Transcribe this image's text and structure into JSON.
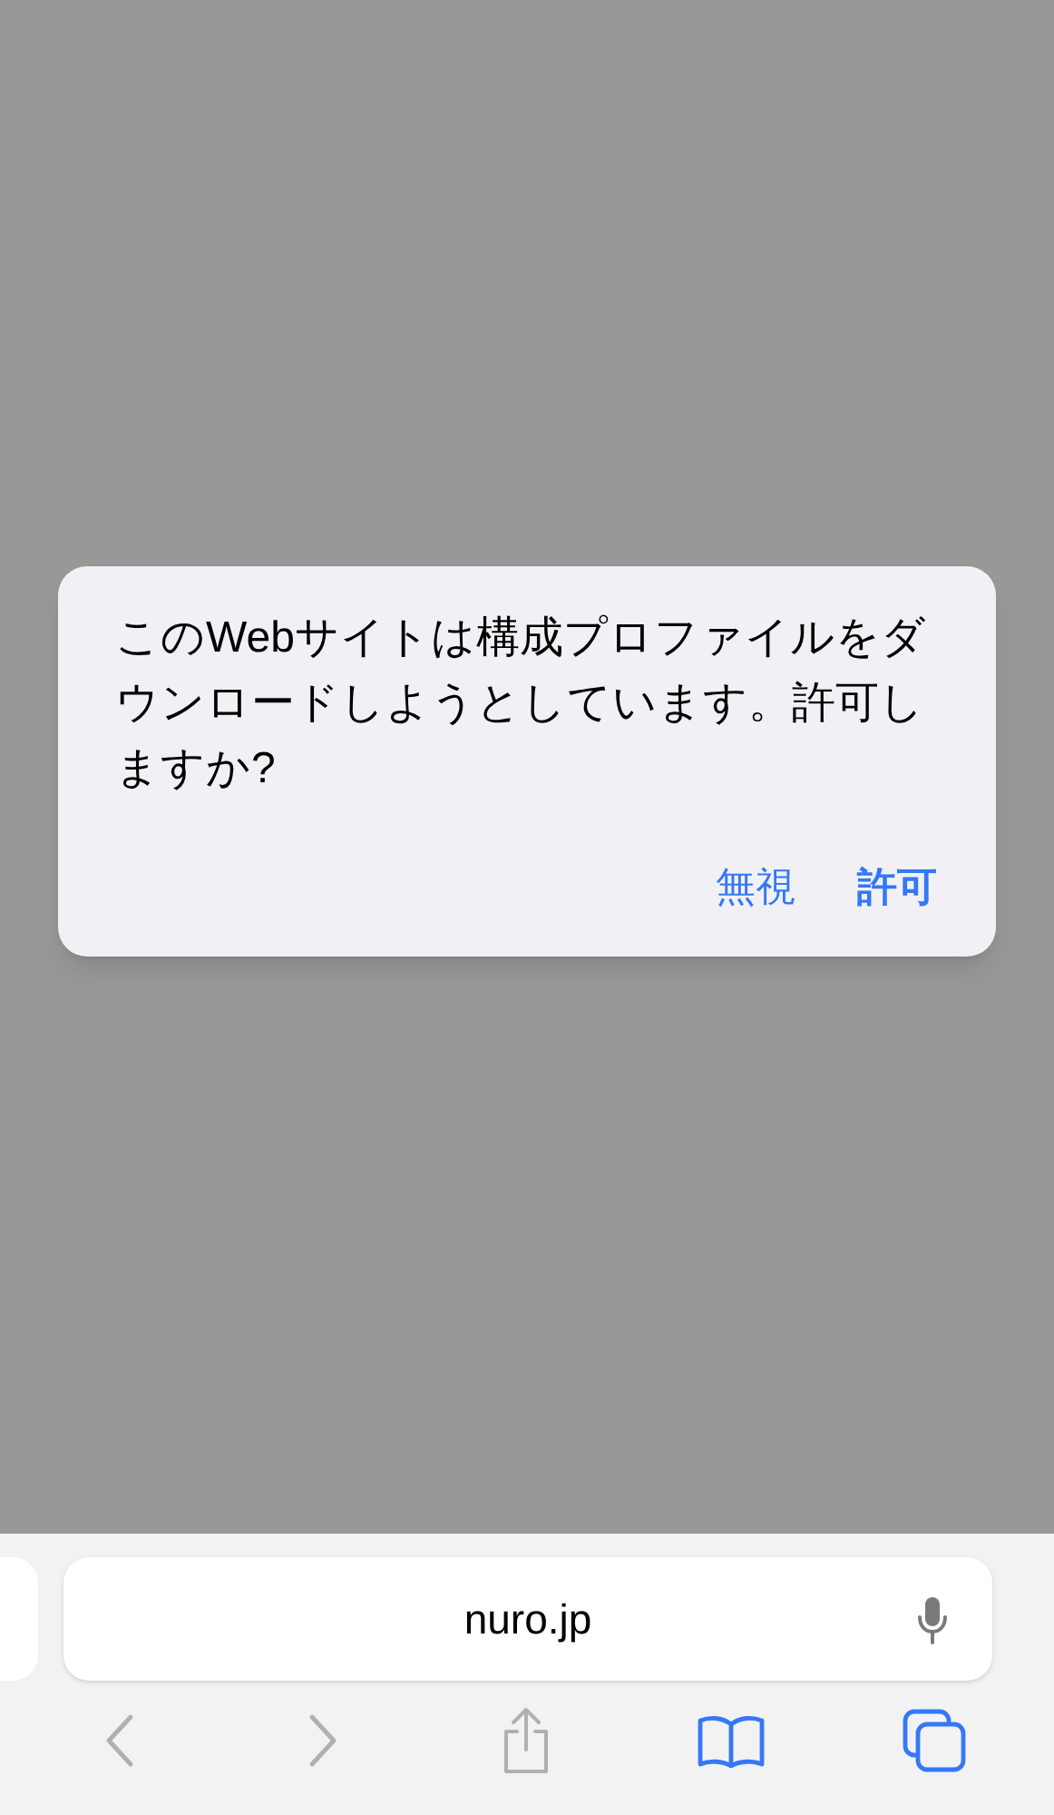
{
  "dialog": {
    "message": "このWebサイトは構成プロファイルをダウンロードしようとしています。許可しますか?",
    "buttons": [
      {
        "label": "無視",
        "primary": false
      },
      {
        "label": "許可",
        "primary": true
      }
    ]
  },
  "address_bar": {
    "url": "nuro.jp"
  },
  "toolbar": [
    {
      "kind": "back",
      "disabled": true
    },
    {
      "kind": "forward",
      "disabled": true
    },
    {
      "kind": "share",
      "disabled": true
    },
    {
      "kind": "bookmarks",
      "disabled": false
    },
    {
      "kind": "tabs",
      "disabled": false
    }
  ]
}
